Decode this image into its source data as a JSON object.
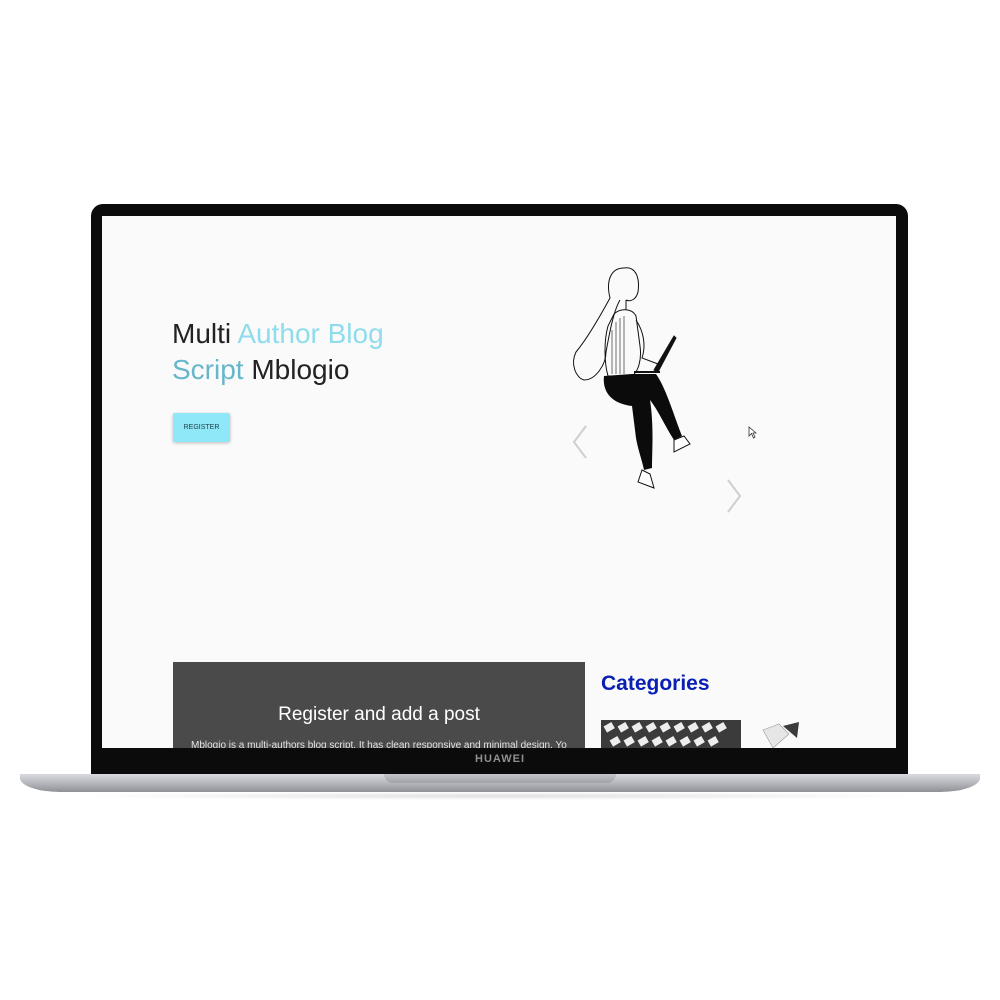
{
  "device": {
    "brand_label": "HUAWEI"
  },
  "hero": {
    "title_word_1": "Multi",
    "title_word_2": "Author Blog",
    "title_word_3": "Script",
    "title_word_4": "Mblogio",
    "register_label": "REGISTER"
  },
  "carousel": {
    "prev_icon": "chevron-left-icon",
    "next_icon": "chevron-right-icon",
    "illustration": "woman-with-laptop-illustration"
  },
  "card": {
    "title": "Register and add a post",
    "text": "Mblogio is a multi-authors blog script. It has clean responsive and minimal design. You can add"
  },
  "sidebar": {
    "categories_heading": "Categories"
  },
  "colors": {
    "accent_light": "#8fdcec",
    "accent_dark": "#67b6cc",
    "button": "#8ee8f7",
    "card_bg": "#4a4a4a",
    "categories_heading": "#0a1fb4"
  }
}
